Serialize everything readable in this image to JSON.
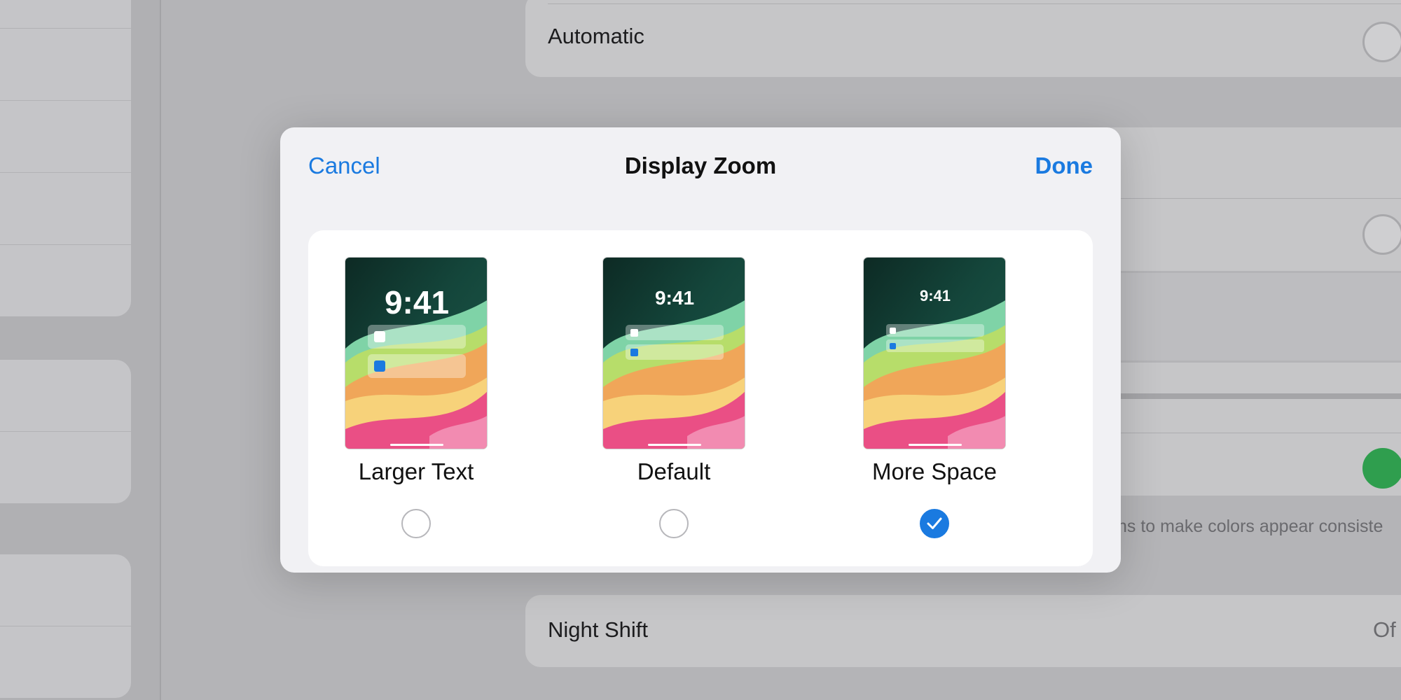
{
  "background": {
    "automatic_label": "Automatic",
    "color_note": "ns to make colors appear consiste",
    "night_shift_label": "Night Shift",
    "night_shift_value": "Of"
  },
  "modal": {
    "title": "Display Zoom",
    "cancel_label": "Cancel",
    "done_label": "Done",
    "options": [
      {
        "label": "Larger Text",
        "preview_time": "9:41",
        "selected": false
      },
      {
        "label": "Default",
        "preview_time": "9:41",
        "selected": false
      },
      {
        "label": "More Space",
        "preview_time": "9:41",
        "selected": true
      }
    ]
  },
  "colors": {
    "accent": "#1a7ae0",
    "toggle_on": "#2f9e4e"
  },
  "icons": {
    "selected": "checkmark-icon"
  }
}
